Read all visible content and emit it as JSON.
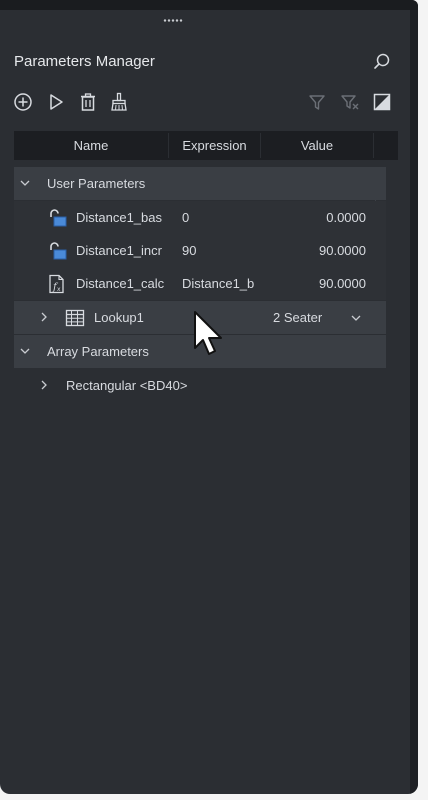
{
  "header": {
    "title": "Parameters Manager"
  },
  "icons": {
    "search": "search-icon",
    "add": "add-circle-icon",
    "run": "play-icon",
    "delete": "trash-icon",
    "purge": "brush-icon",
    "filter": "filter-icon",
    "filter_clear": "filter-clear-icon",
    "toggle": "split-square-icon"
  },
  "table": {
    "columns": [
      "Name",
      "Expression",
      "Value"
    ]
  },
  "groups": {
    "user": "User Parameters",
    "array": "Array Parameters"
  },
  "rows": [
    {
      "name": "Distance1_bas",
      "expression": "0",
      "value": "0.0000"
    },
    {
      "name": "Distance1_incr",
      "expression": "90",
      "value": "90.0000"
    },
    {
      "name": "Distance1_calc",
      "expression": "Distance1_b",
      "value": "90.0000"
    }
  ],
  "lookup": {
    "name": "Lookup1",
    "value": "2 Seater"
  },
  "array_items": [
    {
      "name": "Rectangular <BD40>"
    }
  ],
  "colors": {
    "panel": "#2b2e33",
    "header": "#1c1e22",
    "group": "#3a3e44",
    "accent": "#4a8ad8"
  }
}
